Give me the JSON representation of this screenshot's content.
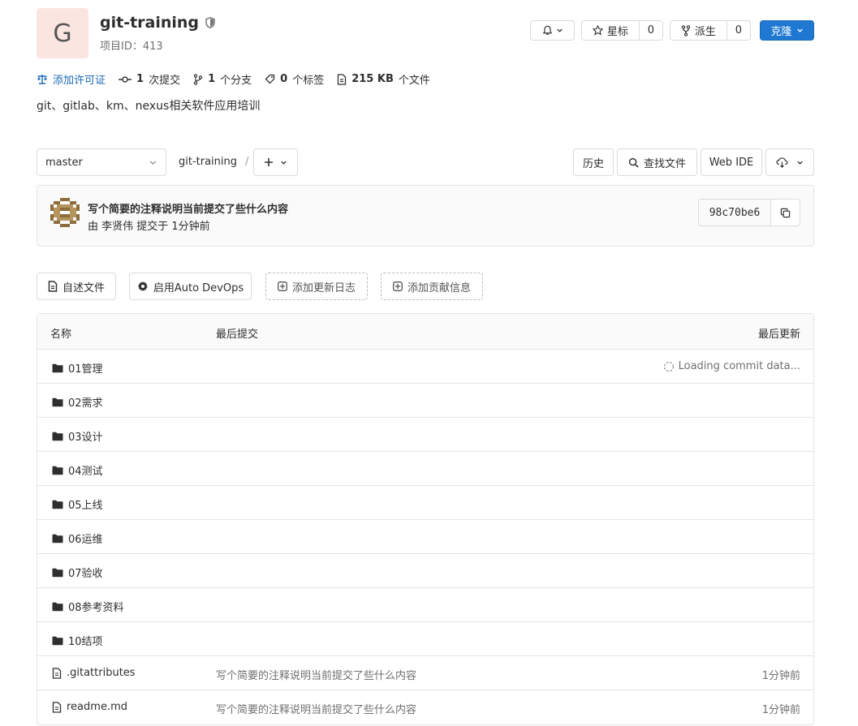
{
  "project": {
    "avatar_letter": "G",
    "name": "git-training",
    "id_label": "项目ID：413",
    "description": "git、gitlab、km、nexus相关软件应用培训"
  },
  "header_buttons": {
    "star_label": "星标",
    "star_count": "0",
    "fork_label": "派生",
    "fork_count": "0",
    "clone_label": "克隆"
  },
  "stats": {
    "license": "添加许可证",
    "commits_num": "1",
    "commits_label": "次提交",
    "branches_num": "1",
    "branches_label": "个分支",
    "tags_num": "0",
    "tags_label": "个标签",
    "size_num": "215 KB",
    "size_label": "个文件"
  },
  "toolbar": {
    "branch": "master",
    "breadcrumb_root": "git-training",
    "breadcrumb_sep": "/",
    "history": "历史",
    "find_file": "查找文件",
    "web_ide": "Web IDE"
  },
  "commit": {
    "title": "写个简要的注释说明当前提交了些什么内容",
    "meta": "由 李贤伟 提交于 1分钟前",
    "sha": "98c70be6"
  },
  "shortcuts": {
    "readme": "自述文件",
    "devops": "启用Auto DevOps",
    "changelog": "添加更新日志",
    "contributing": "添加贡献信息"
  },
  "tree": {
    "headers": {
      "name": "名称",
      "last_commit": "最后提交",
      "last_update": "最后更新"
    },
    "loading": "Loading commit data...",
    "folders": [
      "01管理",
      "02需求",
      "03设计",
      "04测试",
      "05上线",
      "06运维",
      "07验收",
      "08参考资料",
      "10结项"
    ],
    "files": [
      {
        "name": ".gitattributes",
        "message": "写个简要的注释说明当前提交了些什么内容",
        "time": "1分钟前"
      },
      {
        "name": "readme.md",
        "message": "写个简要的注释说明当前提交了些什么内容",
        "time": "1分钟前"
      }
    ]
  },
  "colors": {
    "primary": "#1f78d1",
    "avatar_bg": "#fbe5e1",
    "link": "#1b69b6"
  }
}
